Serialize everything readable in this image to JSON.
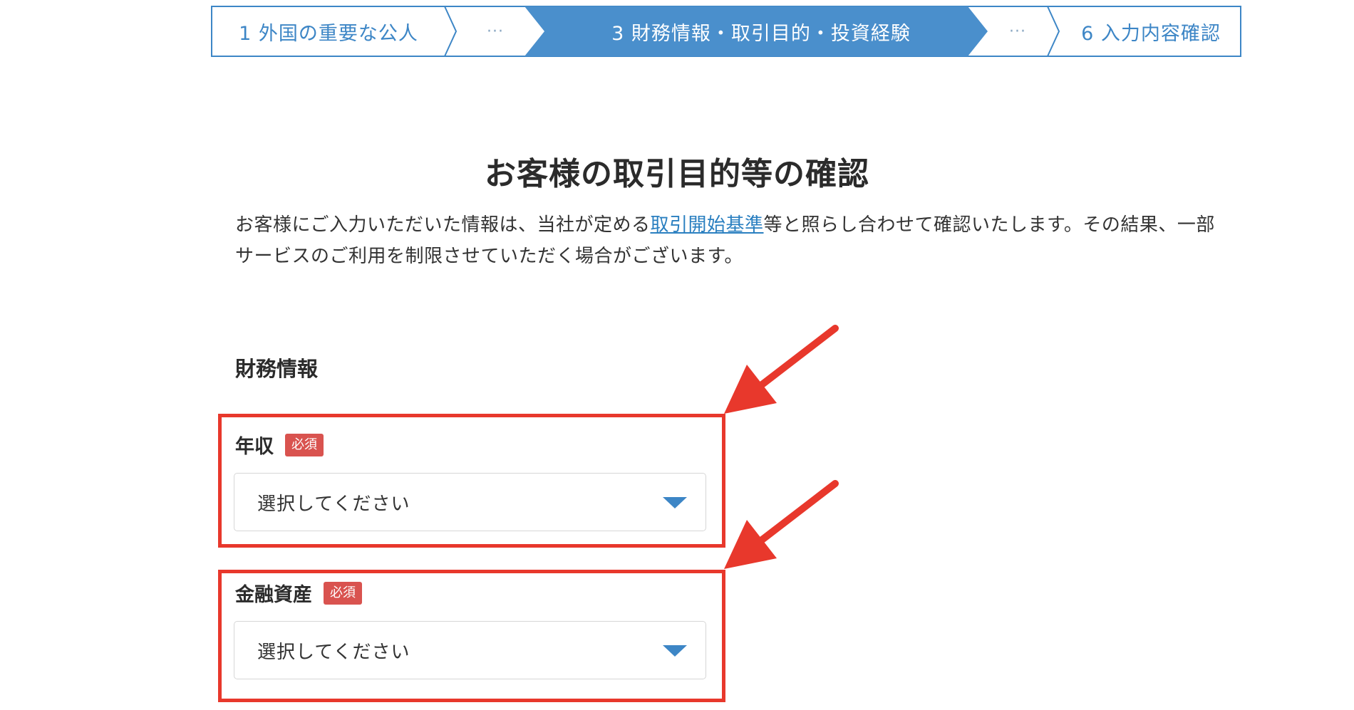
{
  "stepper": {
    "step1": "1 外国の重要な公人",
    "ellipsis_left": "···",
    "step3": "3 財務情報・取引目的・投資経験",
    "ellipsis_right": "···",
    "step6": "6 入力内容確認"
  },
  "page": {
    "title": "お客様の取引目的等の確認",
    "lead_before": "お客様にご入力いただいた情報は、当社が定める",
    "lead_link": "取引開始基準",
    "lead_after": "等と照らし合わせて確認いたします。その結果、一部サービスのご利用を制限させていただく場合がございます。"
  },
  "section": {
    "title": "財務情報"
  },
  "fields": [
    {
      "label": "年収",
      "badge": "必須",
      "value": "選択してください"
    },
    {
      "label": "金融資産",
      "badge": "必須",
      "value": "選択してください"
    }
  ],
  "colors": {
    "accent": "#3d86c6",
    "required": "#d9534f",
    "annotation": "#e8382c"
  }
}
